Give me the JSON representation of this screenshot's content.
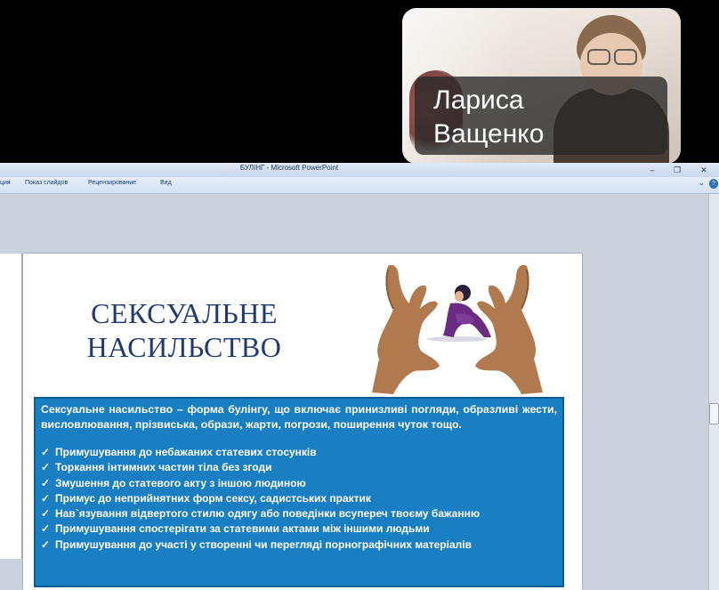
{
  "video": {
    "participant_name": "Лариса\nВащенко"
  },
  "window": {
    "title": "БУЛІНГ - Microsoft PowerPoint",
    "minimize": "–",
    "maximize": "❐",
    "close": "✕"
  },
  "ribbon": {
    "tabs": [
      "ция",
      "Показ слайдов",
      "Рецензирование",
      "Вид"
    ],
    "expand": "⌄",
    "help": "?"
  },
  "slide": {
    "title": "СЕКСУАЛЬНЕ\nНАСИЛЬСТВО",
    "intro": "Сексуальне насильство  – форма булінгу, що включає принизливі погляди, образливі жести, висловлювання, прізвиська, образи, жарти, погрози, поширення чуток тощо.",
    "bullet_glyph": "✓",
    "items": [
      "Примушування до небажаних статевих стосунків",
      "Торкання інтимних частин тіла без згоди",
      "Змушення до статевого акту з іншою людиною",
      "Примус до неприйнятних форм сексу, садистських практик",
      "Нав`язування відвертого стилю одягу або поведінки всупереч твоєму бажанню",
      "Примушування спостерігати за статевими актами між іншими людьми",
      "Примушування до участі у створенні чи перегляді порнографічних матеріалів"
    ]
  },
  "colors": {
    "title_blue": "#1f3a78",
    "box_blue": "#1a7fc2",
    "hand_brown": "#b07a4e",
    "figure_purple": "#6a2c83"
  }
}
